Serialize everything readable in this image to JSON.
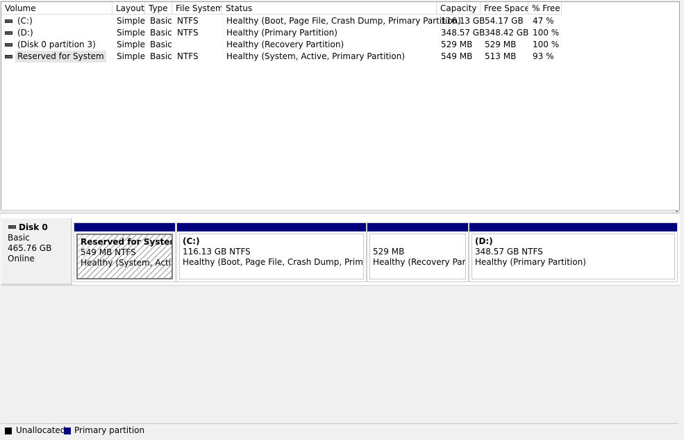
{
  "columns": [
    "Volume",
    "Layout",
    "Type",
    "File System",
    "Status",
    "Capacity",
    "Free Space",
    "% Free"
  ],
  "volumes": [
    {
      "volume": "(C:)",
      "layout": "Simple",
      "type": "Basic",
      "fs": "NTFS",
      "status": "Healthy (Boot, Page File, Crash Dump, Primary Partition)",
      "capacity": "116.13 GB",
      "free": "54.17 GB",
      "pct": "47 %"
    },
    {
      "volume": "(D:)",
      "layout": "Simple",
      "type": "Basic",
      "fs": "NTFS",
      "status": "Healthy (Primary Partition)",
      "capacity": "348.57 GB",
      "free": "348.42 GB",
      "pct": "100 %"
    },
    {
      "volume": "(Disk 0 partition 3)",
      "layout": "Simple",
      "type": "Basic",
      "fs": "",
      "status": "Healthy (Recovery Partition)",
      "capacity": "529 MB",
      "free": "529 MB",
      "pct": "100 %"
    },
    {
      "volume": "Reserved for System",
      "layout": "Simple",
      "type": "Basic",
      "fs": "NTFS",
      "status": "Healthy (System, Active, Primary Partition)",
      "capacity": "549 MB",
      "free": "513 MB",
      "pct": "93 %"
    }
  ],
  "disk": {
    "name": "Disk 0",
    "type": "Basic",
    "size": "465.76 GB",
    "state": "Online"
  },
  "partitions": [
    {
      "name": "Reserved for System",
      "size": "549 MB NTFS",
      "status": "Healthy (System, Active, Primary Partition)"
    },
    {
      "name": "(C:)",
      "size": "116.13 GB NTFS",
      "status": "Healthy (Boot, Page File, Crash Dump, Primary Partition)"
    },
    {
      "name": "",
      "size": "529 MB",
      "status": "Healthy (Recovery Partition)"
    },
    {
      "name": "(D:)",
      "size": "348.57 GB NTFS",
      "status": "Healthy (Primary Partition)"
    }
  ],
  "legend": {
    "unallocated": "Unallocated",
    "primary": "Primary partition"
  },
  "colors": {
    "primary_partition": "#00007f",
    "unallocated": "#000000"
  }
}
